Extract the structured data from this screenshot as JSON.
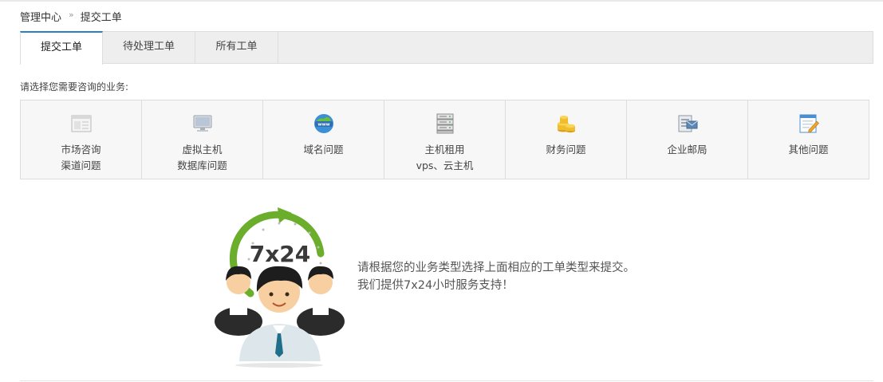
{
  "breadcrumb": {
    "home": "管理中心",
    "separator": "»",
    "current": "提交工单"
  },
  "tabs": [
    {
      "label": "提交工单",
      "active": true
    },
    {
      "label": "待处理工单",
      "active": false
    },
    {
      "label": "所有工单",
      "active": false
    }
  ],
  "prompt": "请选择您需要咨询的业务:",
  "categories": [
    {
      "line1": "市场咨询",
      "line2": "渠道问题",
      "icon": "window-icon"
    },
    {
      "line1": "虚拟主机",
      "line2": "数据库问题",
      "icon": "monitor-icon"
    },
    {
      "line1": "域名问题",
      "line2": "",
      "icon": "www-globe-icon"
    },
    {
      "line1": "主机租用",
      "line2": "vps、云主机",
      "icon": "server-rack-icon"
    },
    {
      "line1": "财务问题",
      "line2": "",
      "icon": "coins-icon"
    },
    {
      "line1": "企业邮局",
      "line2": "",
      "icon": "mail-icon"
    },
    {
      "line1": "其他问题",
      "line2": "",
      "icon": "notepad-pencil-icon"
    }
  ],
  "hero": {
    "badge": "7x24"
  },
  "message": {
    "line1": "请根据您的业务类型选择上面相应的工单类型来提交。",
    "line2": "我们提供7x24小时服务支持！"
  },
  "colors": {
    "tab_active_border": "#2c7fc6",
    "tab_bar_bg": "#eeeeee",
    "category_bg": "#f7f7f7",
    "arrow_green": "#6aae2c"
  }
}
